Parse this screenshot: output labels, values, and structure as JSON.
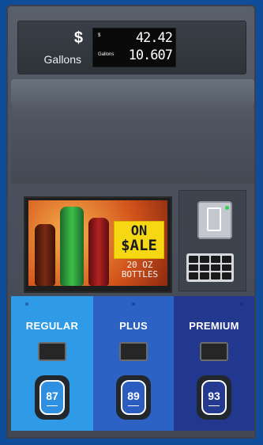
{
  "display": {
    "dollar_label": "$",
    "gallons_label": "Gallons",
    "lcd_dollar_tag": "$",
    "lcd_gallons_tag": "Gallons",
    "amount": "42.42",
    "gallons": "10.607"
  },
  "ad": {
    "headline_line1": "ON",
    "headline_line2": "$ALE",
    "size_line1": "20 OZ",
    "size_line2": "BOTTLES"
  },
  "grades": [
    {
      "name": "REGULAR",
      "octane": "87",
      "color": "#2f9be6"
    },
    {
      "name": "PLUS",
      "octane": "89",
      "color": "#2b62c4"
    },
    {
      "name": "PREMIUM",
      "octane": "93",
      "color": "#22388f"
    }
  ],
  "colors": {
    "background": "#0f4d9a",
    "sale_tag": "#f6d714"
  }
}
